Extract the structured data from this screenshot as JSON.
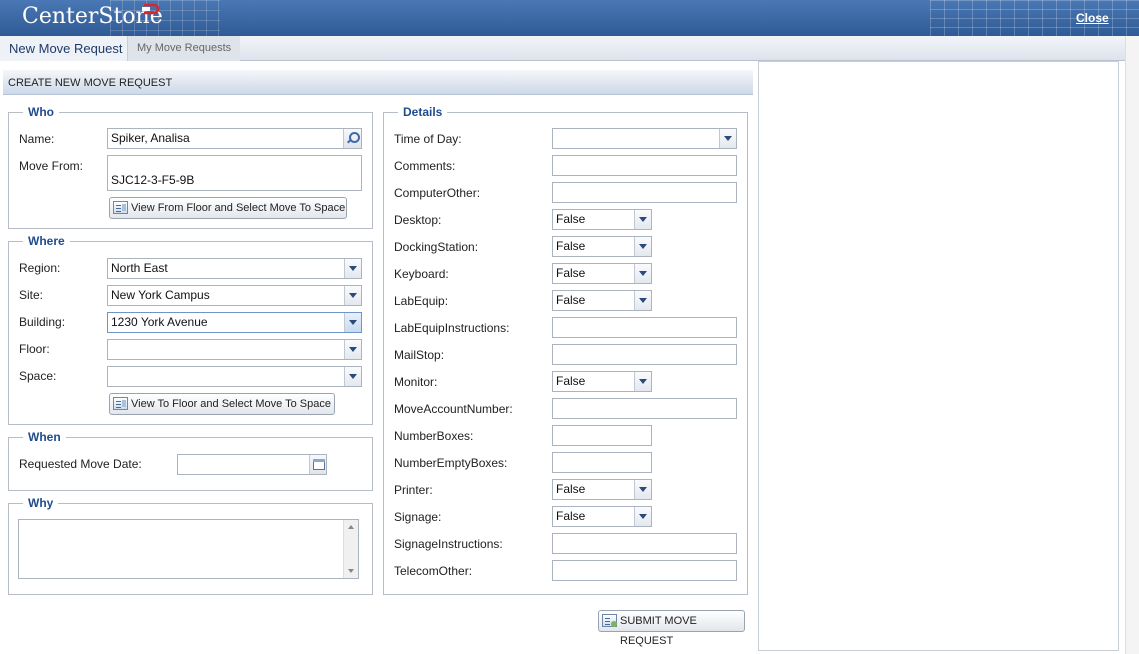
{
  "app": {
    "logo_text": "CenterStone",
    "close_label": "Close"
  },
  "tabs": [
    {
      "label": "New Move Request"
    },
    {
      "label": "My Move Requests"
    }
  ],
  "section_title": "CREATE NEW MOVE REQUEST",
  "who": {
    "legend": "Who",
    "name_label": "Name:",
    "name_value": "Spiker, Analisa",
    "move_from_label": "Move From:",
    "move_from_value": "SJC12-3-F5-9B",
    "view_from_button": "View From Floor and Select Move To Space"
  },
  "where": {
    "legend": "Where",
    "fields": [
      {
        "label": "Region:",
        "value": "North East"
      },
      {
        "label": "Site:",
        "value": "New York Campus"
      },
      {
        "label": "Building:",
        "value": "1230 York Avenue"
      },
      {
        "label": "Floor:",
        "value": ""
      },
      {
        "label": "Space:",
        "value": ""
      }
    ],
    "view_to_button": "View To Floor and Select Move To Space"
  },
  "when": {
    "legend": "When",
    "date_label": "Requested Move Date:",
    "date_value": ""
  },
  "why": {
    "legend": "Why",
    "text": ""
  },
  "details": {
    "legend": "Details",
    "fields": [
      {
        "label": "Time of Day:",
        "value": ""
      },
      {
        "label": "Comments:",
        "value": ""
      },
      {
        "label": "ComputerOther:",
        "value": ""
      },
      {
        "label": "Desktop:",
        "value": "False"
      },
      {
        "label": "DockingStation:",
        "value": "False"
      },
      {
        "label": "Keyboard:",
        "value": "False"
      },
      {
        "label": "LabEquip:",
        "value": "False"
      },
      {
        "label": "LabEquipInstructions:",
        "value": ""
      },
      {
        "label": "MailStop:",
        "value": ""
      },
      {
        "label": "Monitor:",
        "value": "False"
      },
      {
        "label": "MoveAccountNumber:",
        "value": ""
      },
      {
        "label": "NumberBoxes:",
        "value": ""
      },
      {
        "label": "NumberEmptyBoxes:",
        "value": ""
      },
      {
        "label": "Printer:",
        "value": "False"
      },
      {
        "label": "Signage:",
        "value": "False"
      },
      {
        "label": "SignageInstructions:",
        "value": ""
      },
      {
        "label": "TelecomOther:",
        "value": ""
      }
    ]
  },
  "submit_label": "SUBMIT MOVE REQUEST",
  "colors": {
    "header": "#3a67a3",
    "legend": "#1f4c8c",
    "tab_active_text": "#1d3b6a"
  }
}
